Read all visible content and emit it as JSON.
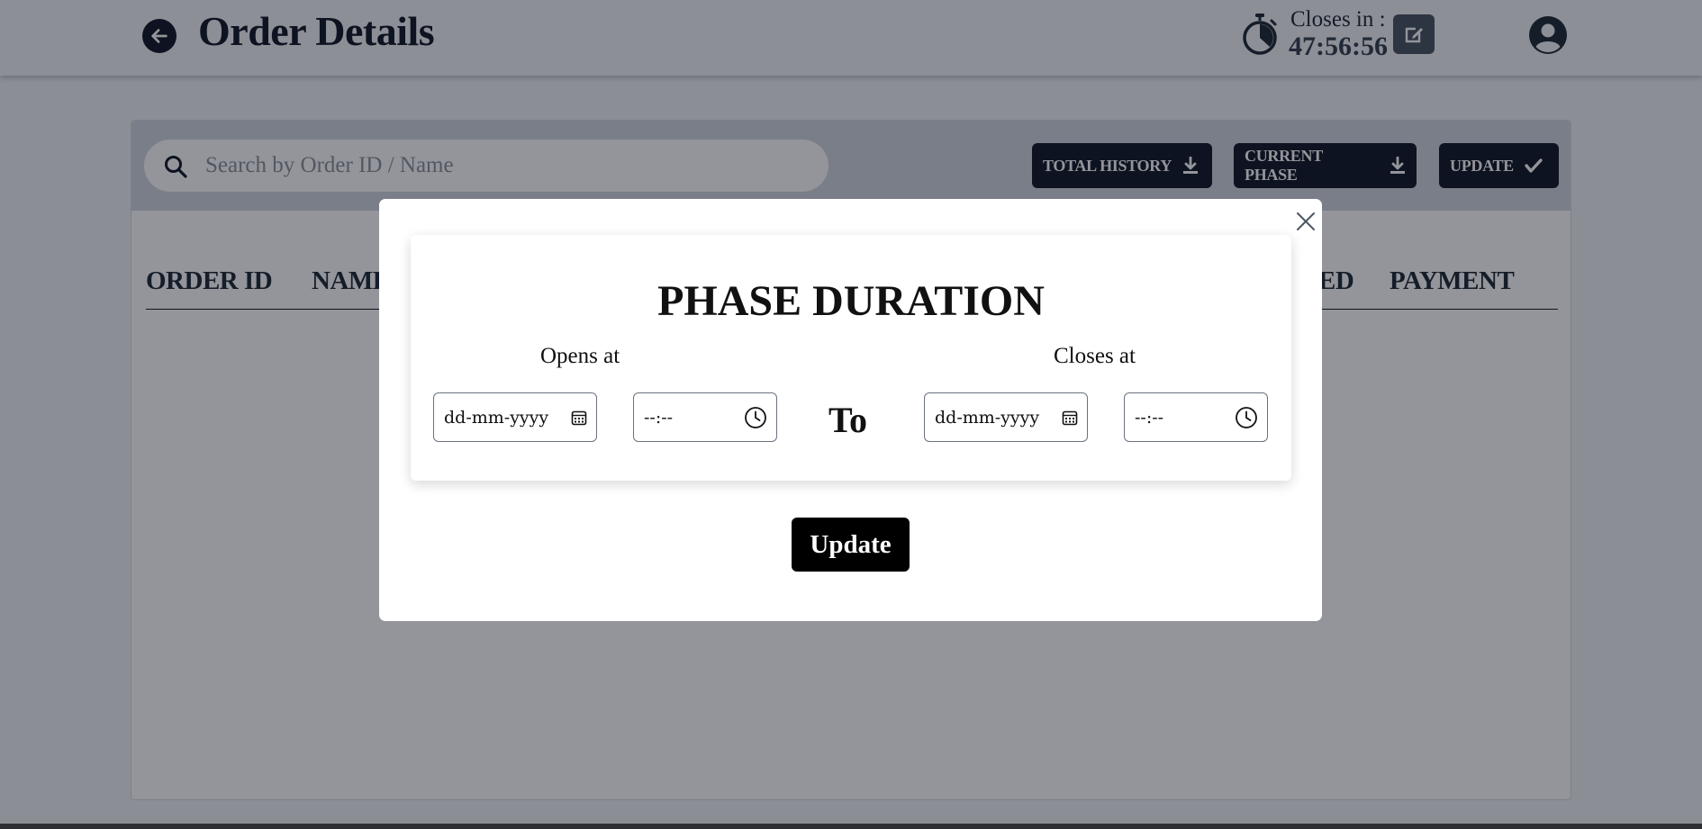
{
  "header": {
    "title": "Order Details",
    "closes_label": "Closes in :",
    "closes_value": "47:56:56"
  },
  "toolbar": {
    "search_placeholder": "Search by Order ID / Name",
    "buttons": [
      {
        "label": "TOTAL HISTORY",
        "icon": "download-icon"
      },
      {
        "label": "CURRENT PHASE",
        "icon": "download-icon"
      },
      {
        "label": "UPDATE",
        "icon": "check-icon"
      }
    ]
  },
  "table": {
    "columns": [
      "ORDER ID",
      "NAME",
      "ED",
      "PAYMENT"
    ]
  },
  "modal": {
    "title": "PHASE DURATION",
    "opens_label": "Opens at",
    "closes_label": "Closes at",
    "to_label": "To",
    "open_date_placeholder": "dd-mm-yyyy",
    "open_time_placeholder": "--:--",
    "close_date_placeholder": "dd-mm-yyyy",
    "close_time_placeholder": "--:--",
    "update_label": "Update"
  },
  "colors": {
    "dark": "#111827",
    "overlay": "rgba(8,14,26,0.44)",
    "page_bg": "#f1f3f6",
    "toolbar_bg": "#d3d7df"
  }
}
